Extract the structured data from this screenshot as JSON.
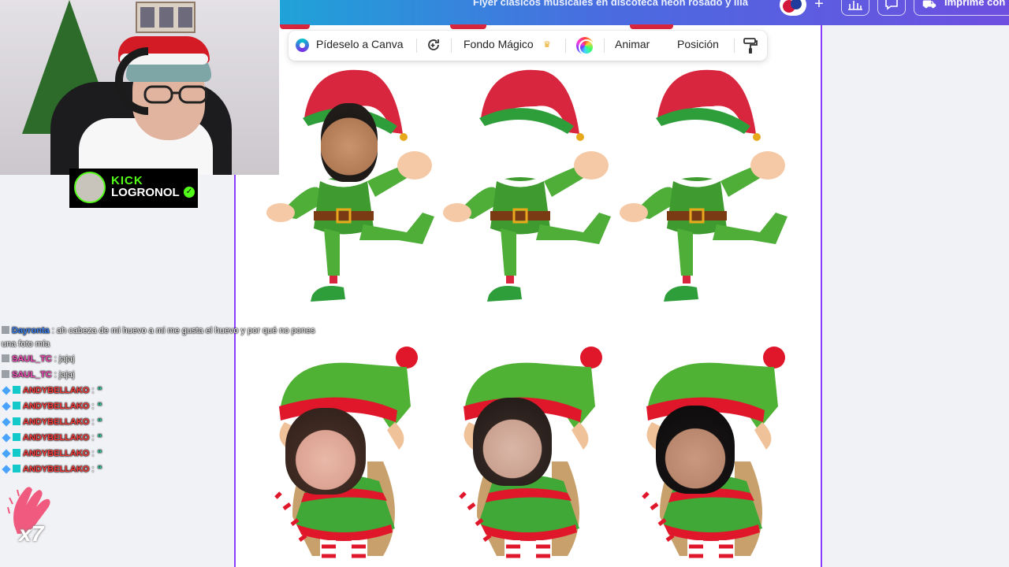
{
  "canva": {
    "document_title": "Flyer clásicos musicales en discoteca neón rosado y lila",
    "print_label": "Imprime con",
    "colors": {
      "accent": "#8b3dff",
      "header_start": "#1fa3d8",
      "header_end": "#6e4fe0"
    }
  },
  "toolbar": {
    "ask_canva": "Pídeselo a Canva",
    "magic_bg": "Fondo Mágico",
    "animate": "Animar",
    "position": "Posición"
  },
  "stream": {
    "platform": "KICK",
    "channel": "LOGRONOL",
    "brand_color": "#53fc18"
  },
  "chat": [
    {
      "user": "Dayronta",
      "message": ": ah cabeza de mi huevo a mi me gusta el huevo y por qué no pones una foto mía",
      "style": "dayronta"
    },
    {
      "user": "SAUL_TC",
      "message": ": jajaj",
      "style": "saul"
    },
    {
      "user": "SAUL_TC",
      "message": ": jajaj",
      "style": "saul"
    },
    {
      "user": "ANDYBELLAKO",
      "message": ":",
      "style": "andy"
    },
    {
      "user": "ANDYBELLAKO",
      "message": ":",
      "style": "andy"
    },
    {
      "user": "ANDYBELLAKO",
      "message": ":",
      "style": "andy"
    },
    {
      "user": "ANDYBELLAKO",
      "message": ":",
      "style": "andy"
    },
    {
      "user": "ANDYBELLAKO",
      "message": ":",
      "style": "andy"
    },
    {
      "user": "ANDYBELLAKO",
      "message": ":",
      "style": "andy"
    }
  ],
  "reaction": {
    "count": "x7"
  }
}
